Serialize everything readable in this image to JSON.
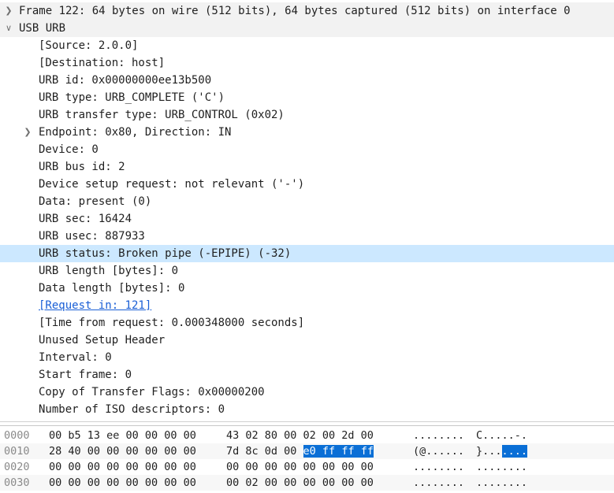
{
  "tree": {
    "frame": {
      "arrow": "❯",
      "text": "Frame 122: 64 bytes on wire (512 bits), 64 bytes captured (512 bits) on interface 0"
    },
    "usb_urb": {
      "arrow": "∨",
      "text": "USB URB"
    },
    "fields": [
      {
        "text": "[Source: 2.0.0]"
      },
      {
        "text": "[Destination: host]"
      },
      {
        "text": "URB id: 0x00000000ee13b500"
      },
      {
        "text": "URB type: URB_COMPLETE ('C')"
      },
      {
        "text": "URB transfer type: URB_CONTROL (0x02)"
      },
      {
        "text": "Endpoint: 0x80, Direction: IN",
        "arrow": "❯"
      },
      {
        "text": "Device: 0"
      },
      {
        "text": "URB bus id: 2"
      },
      {
        "text": "Device setup request: not relevant ('-')"
      },
      {
        "text": "Data: present (0)"
      },
      {
        "text": "URB sec: 16424"
      },
      {
        "text": "URB usec: 887933"
      },
      {
        "text": "URB status: Broken pipe (-EPIPE) (-32)",
        "selected": true
      },
      {
        "text": "URB length [bytes]: 0"
      },
      {
        "text": "Data length [bytes]: 0"
      },
      {
        "text": "[Request in: 121]",
        "link": true
      },
      {
        "text": "[Time from request: 0.000348000 seconds]"
      },
      {
        "text": "Unused Setup Header"
      },
      {
        "text": "Interval: 0"
      },
      {
        "text": "Start frame: 0"
      },
      {
        "text": "Copy of Transfer Flags: 0x00000200"
      },
      {
        "text": "Number of ISO descriptors: 0"
      }
    ]
  },
  "bytes": {
    "rows": [
      {
        "offset": "0000",
        "hex1": "00 b5 13 ee 00 00 00 00",
        "hex2a": "43 02 80 00 02 00 2d 00",
        "hex2b": "",
        "ascii1": "........",
        "ascii2a": "C.....-.",
        "ascii2b": ""
      },
      {
        "offset": "0010",
        "hex1": "28 40 00 00 00 00 00 00",
        "hex2a": "7d 8c 0d 00 ",
        "hex2b": "e0 ff ff ff",
        "ascii1": "(@......",
        "ascii2a": "}...",
        "ascii2b": "...."
      },
      {
        "offset": "0020",
        "hex1": "00 00 00 00 00 00 00 00",
        "hex2a": "00 00 00 00 00 00 00 00",
        "hex2b": "",
        "ascii1": "........",
        "ascii2a": "........",
        "ascii2b": ""
      },
      {
        "offset": "0030",
        "hex1": "00 00 00 00 00 00 00 00",
        "hex2a": "00 02 00 00 00 00 00 00",
        "hex2b": "",
        "ascii1": "........",
        "ascii2a": "........",
        "ascii2b": ""
      }
    ]
  },
  "colors": {
    "selection": "#cce8ff",
    "byte_highlight": "#0a6fd6",
    "link": "#1a5fd6"
  }
}
